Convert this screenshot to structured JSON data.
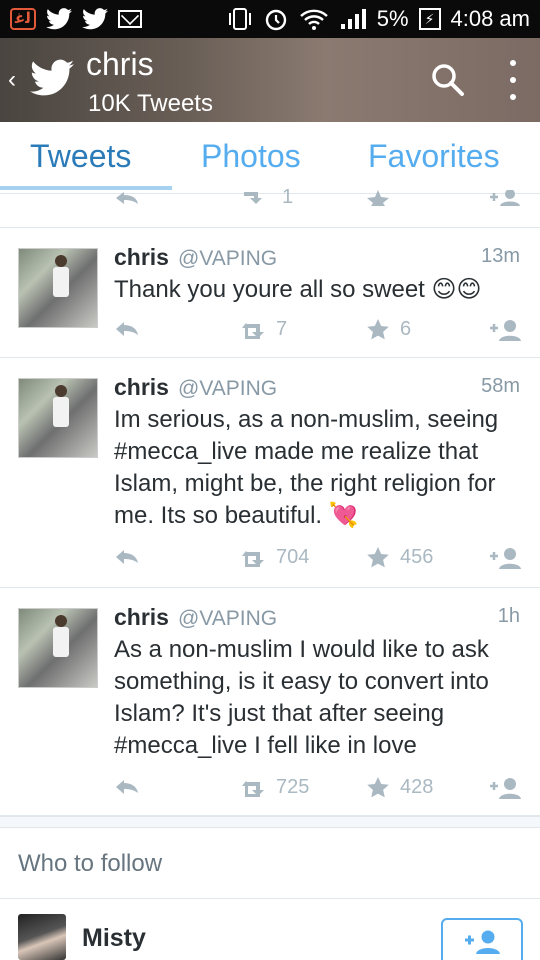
{
  "status_bar": {
    "notification_badge": "ﻟﻏ",
    "battery": "5%",
    "time": "4:08 am",
    "icons": [
      "twitter-bird-icon",
      "twitter-bird-icon",
      "mail-icon",
      "vibrate-icon",
      "alarm-icon",
      "wifi-icon",
      "signal-icon",
      "battery-charging-icon"
    ]
  },
  "header": {
    "title": "chris",
    "subtitle": "10K Tweets",
    "icons": [
      "back-icon",
      "twitter-bird-icon",
      "search-icon",
      "more-icon"
    ]
  },
  "tabs": [
    {
      "label": "Tweets",
      "active": true
    },
    {
      "label": "Photos",
      "active": false
    },
    {
      "label": "Favorites",
      "active": false
    }
  ],
  "partial_row": {
    "retweets": "1"
  },
  "tweets": [
    {
      "name": "chris",
      "handle": "@VAPING",
      "time": "13m",
      "text": "Thank you youre all so sweet 😊😊",
      "retweets": "7",
      "favorites": "6"
    },
    {
      "name": "chris",
      "handle": "@VAPING",
      "time": "58m",
      "text": "Im serious, as a non-muslim, seeing #mecca_live made me realize that Islam, might be, the right religion for me. Its so beautiful. 💘",
      "retweets": "704",
      "favorites": "456"
    },
    {
      "name": "chris",
      "handle": "@VAPING",
      "time": "1h",
      "text": "As a non-muslim I would like to ask something, is it easy to convert into Islam? It's just that after seeing #mecca_live I fell like in love",
      "retweets": "725",
      "favorites": "428"
    }
  ],
  "who_to_follow": {
    "title": "Who to follow",
    "users": [
      {
        "name": "Misty"
      }
    ]
  },
  "colors": {
    "accent": "#55acee",
    "muted": "#aab8c2",
    "text": "#292f33",
    "secondary": "#8899a6"
  }
}
